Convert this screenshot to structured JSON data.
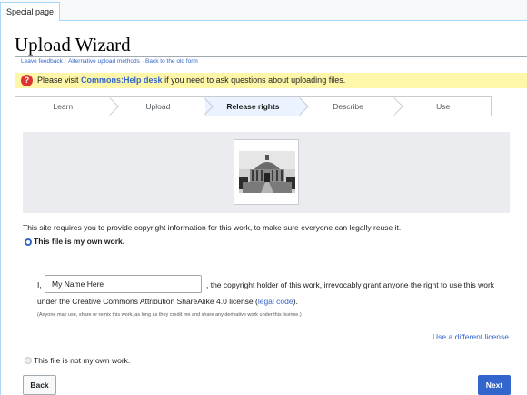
{
  "tab": {
    "label": "Special page"
  },
  "page": {
    "title": "Upload Wizard"
  },
  "links": [
    {
      "label": "Leave feedback"
    },
    {
      "label": "Alternative upload methods"
    },
    {
      "label": "Back to the old form"
    }
  ],
  "notice": {
    "pre": "Please visit ",
    "link": "Commons:Help desk",
    "post": " if you need to ask questions about uploading files."
  },
  "steps": [
    {
      "label": "Learn",
      "active": false
    },
    {
      "label": "Upload",
      "active": false
    },
    {
      "label": "Release rights",
      "active": true
    },
    {
      "label": "Describe",
      "active": false
    },
    {
      "label": "Use",
      "active": false
    }
  ],
  "release": {
    "intro": "This site requires you to provide copyright information for this work, to make sure everyone can legally reuse it.",
    "option_own": "This file is my own work.",
    "option_own_checked": true,
    "prefix": "I,",
    "name_value": "My Name Here",
    "grant_text": ", the copyright holder of this work, irrevocably grant anyone the right to use this work",
    "license_text": "under the Creative Commons Attribution ShareAlike 4.0 license (",
    "legal_code": "legal code",
    "license_close": ").",
    "fineprint": "(Anyone may use, share or remix this work, as long as they credit me and share any derivative work under this license.)",
    "different_license": "Use a different license",
    "option_not_own": "This file is not my own work.",
    "option_not_own_checked": false
  },
  "buttons": {
    "back": "Back",
    "next": "Next"
  },
  "colors": {
    "accent": "#3366cc",
    "notice_bg": "#fef6a8",
    "active_step": "#eaf3ff"
  }
}
